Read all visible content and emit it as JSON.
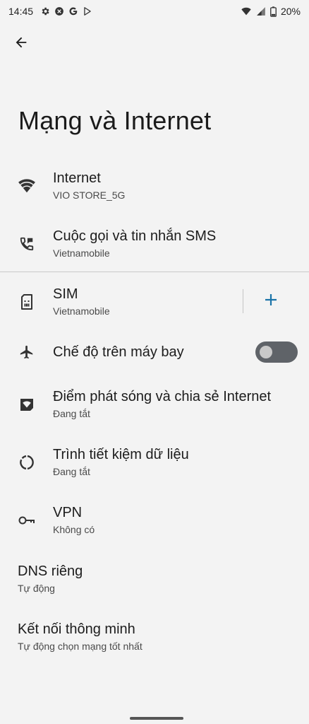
{
  "status_bar": {
    "time": "14:45",
    "battery": "20%",
    "left_icons": [
      "settings-gear-icon",
      "sync-icon",
      "google-icon",
      "play-store-icon"
    ],
    "right_icons": [
      "wifi-icon",
      "cell-signal-icon",
      "battery-icon"
    ]
  },
  "page": {
    "title": "Mạng và Internet"
  },
  "items": [
    {
      "title": "Internet",
      "subtitle": "VIO STORE_5G",
      "icon": "wifi-icon"
    },
    {
      "title": "Cuộc gọi và tin nhắn SMS",
      "subtitle": "Vietnamobile",
      "icon": "phone-message-icon"
    },
    {
      "title": "SIM",
      "subtitle": "Vietnamobile",
      "icon": "sim-card-icon"
    },
    {
      "title": "Chế độ trên máy bay",
      "subtitle": "",
      "icon": "airplane-icon"
    },
    {
      "title": "Điểm phát sóng và chia sẻ Internet",
      "subtitle": "Đang tắt",
      "icon": "hotspot-icon"
    },
    {
      "title": "Trình tiết kiệm dữ liệu",
      "subtitle": "Đang tắt",
      "icon": "data-saver-icon"
    },
    {
      "title": "VPN",
      "subtitle": "Không có",
      "icon": "vpn-key-icon"
    },
    {
      "title": "DNS riêng",
      "subtitle": "Tự động"
    },
    {
      "title": "Kết nối thông minh",
      "subtitle": "Tự động chọn mạng tốt nhất"
    }
  ],
  "airplane_mode": {
    "enabled": false
  },
  "colors": {
    "background": "#f3f3f3",
    "accent": "#1a73a8",
    "toggle_track": "#5f6368"
  }
}
